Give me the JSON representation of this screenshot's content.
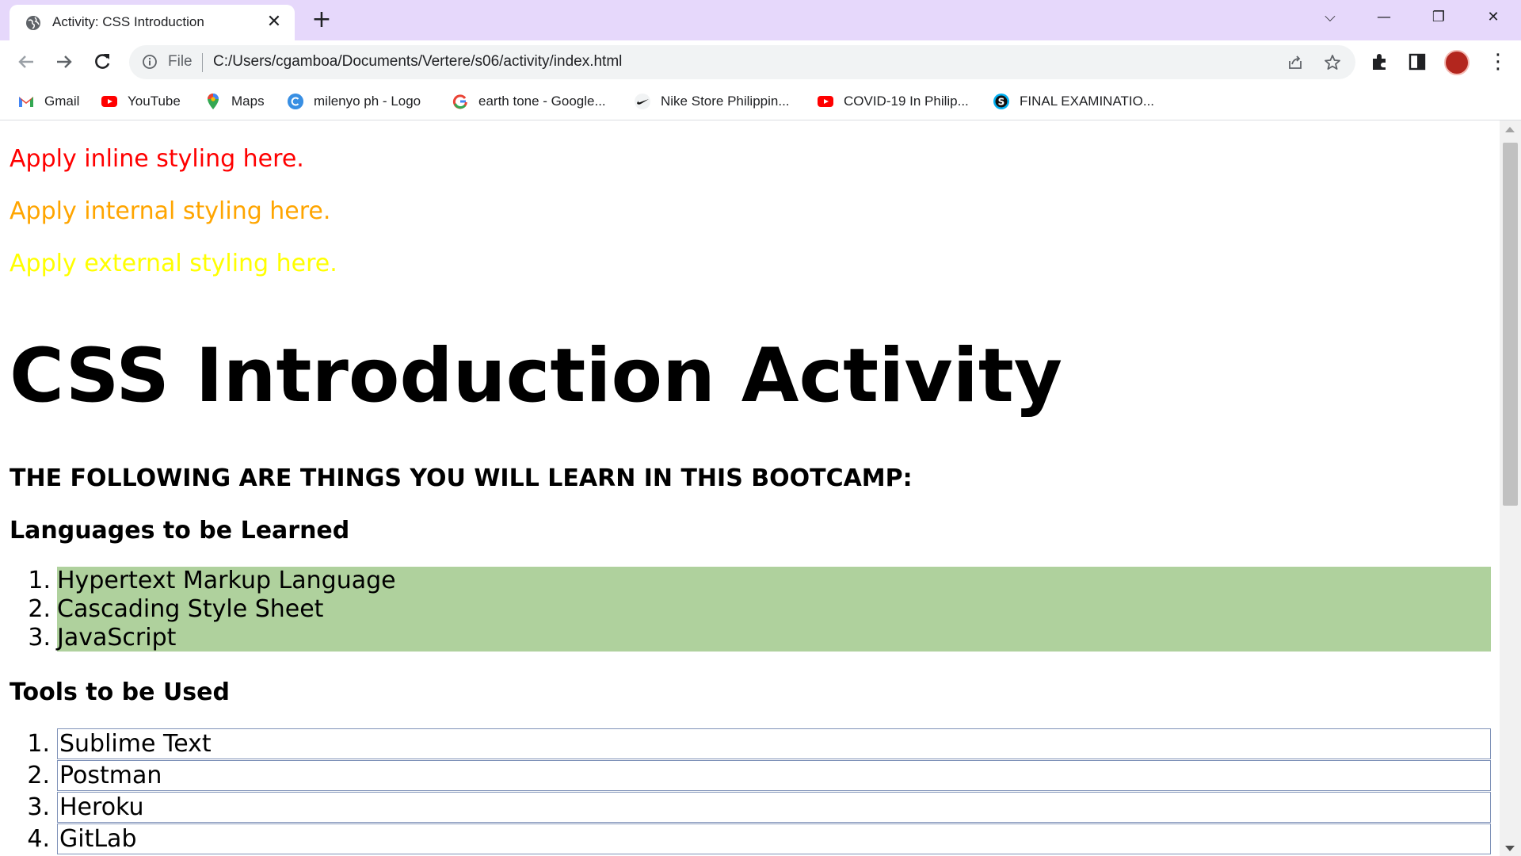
{
  "tab": {
    "title": "Activity: CSS Introduction",
    "favicon": "globe-icon",
    "close_label": "✕"
  },
  "new_tab_label": "+",
  "window_controls": {
    "tab_search": "⌵",
    "minimize": "—",
    "restore": "❐",
    "close": "✕"
  },
  "omnibox": {
    "scheme_label": "File",
    "url": "C:/Users/cgamboa/Documents/Vertere/s06/activity/index.html"
  },
  "bookmarks": [
    {
      "label": "Gmail",
      "icon": "gmail-icon"
    },
    {
      "label": "YouTube",
      "icon": "youtube-icon"
    },
    {
      "label": "Maps",
      "icon": "maps-icon"
    },
    {
      "label": "milenyo ph - Logo",
      "icon": "canva-icon"
    },
    {
      "label": "earth tone - Google...",
      "icon": "google-icon"
    },
    {
      "label": "Nike Store Philippin...",
      "icon": "nike-icon"
    },
    {
      "label": "COVID-19 In Philip...",
      "icon": "youtube-icon"
    },
    {
      "label": "FINAL EXAMINATIO...",
      "icon": "skype-icon"
    }
  ],
  "page": {
    "inline_text": "Apply inline styling here.",
    "internal_text": "Apply internal styling here.",
    "external_text": "Apply external styling here.",
    "heading": "CSS Introduction Activity",
    "subheading": "THE FOLLOWING ARE THINGS YOU WILL LEARN IN THIS BOOTCAMP:",
    "languages_heading": "Languages to be Learned",
    "languages": [
      {
        "num": "1.",
        "label": "Hypertext Markup Language"
      },
      {
        "num": "2.",
        "label": "Cascading Style Sheet"
      },
      {
        "num": "3.",
        "label": "JavaScript"
      }
    ],
    "tools_heading": "Tools to be Used",
    "tools": [
      {
        "num": "1.",
        "label": "Sublime Text"
      },
      {
        "num": "2.",
        "label": "Postman"
      },
      {
        "num": "3.",
        "label": "Heroku"
      },
      {
        "num": "4.",
        "label": "GitLab"
      }
    ]
  },
  "colors": {
    "tabstrip": "#e6d8fb",
    "inline_text": "#ff0000",
    "internal_text": "#ffa500",
    "external_text": "#ffff00",
    "languages_bg": "#afd19d",
    "tools_border": "#7f92b8"
  }
}
